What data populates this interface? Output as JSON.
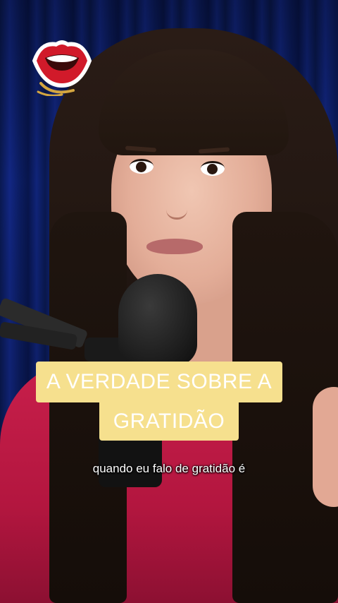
{
  "video": {
    "title_line_1": "A VERDADE SOBRE A",
    "title_line_2": "GRATIDÃO",
    "caption": "quando eu falo de gratidão é",
    "title_bg_color": "#f6e08e",
    "title_text_color": "#ffffff",
    "caption_text_color": "#ffffff"
  },
  "logo": {
    "icon": "lips-icon",
    "colors": {
      "lips": "#d11a2a",
      "teeth": "#ffffff",
      "ring": "#d4a640"
    }
  },
  "scene": {
    "backdrop_color": "#13298a",
    "shirt_color": "#c81f4b",
    "hair_color": "#21160f"
  }
}
